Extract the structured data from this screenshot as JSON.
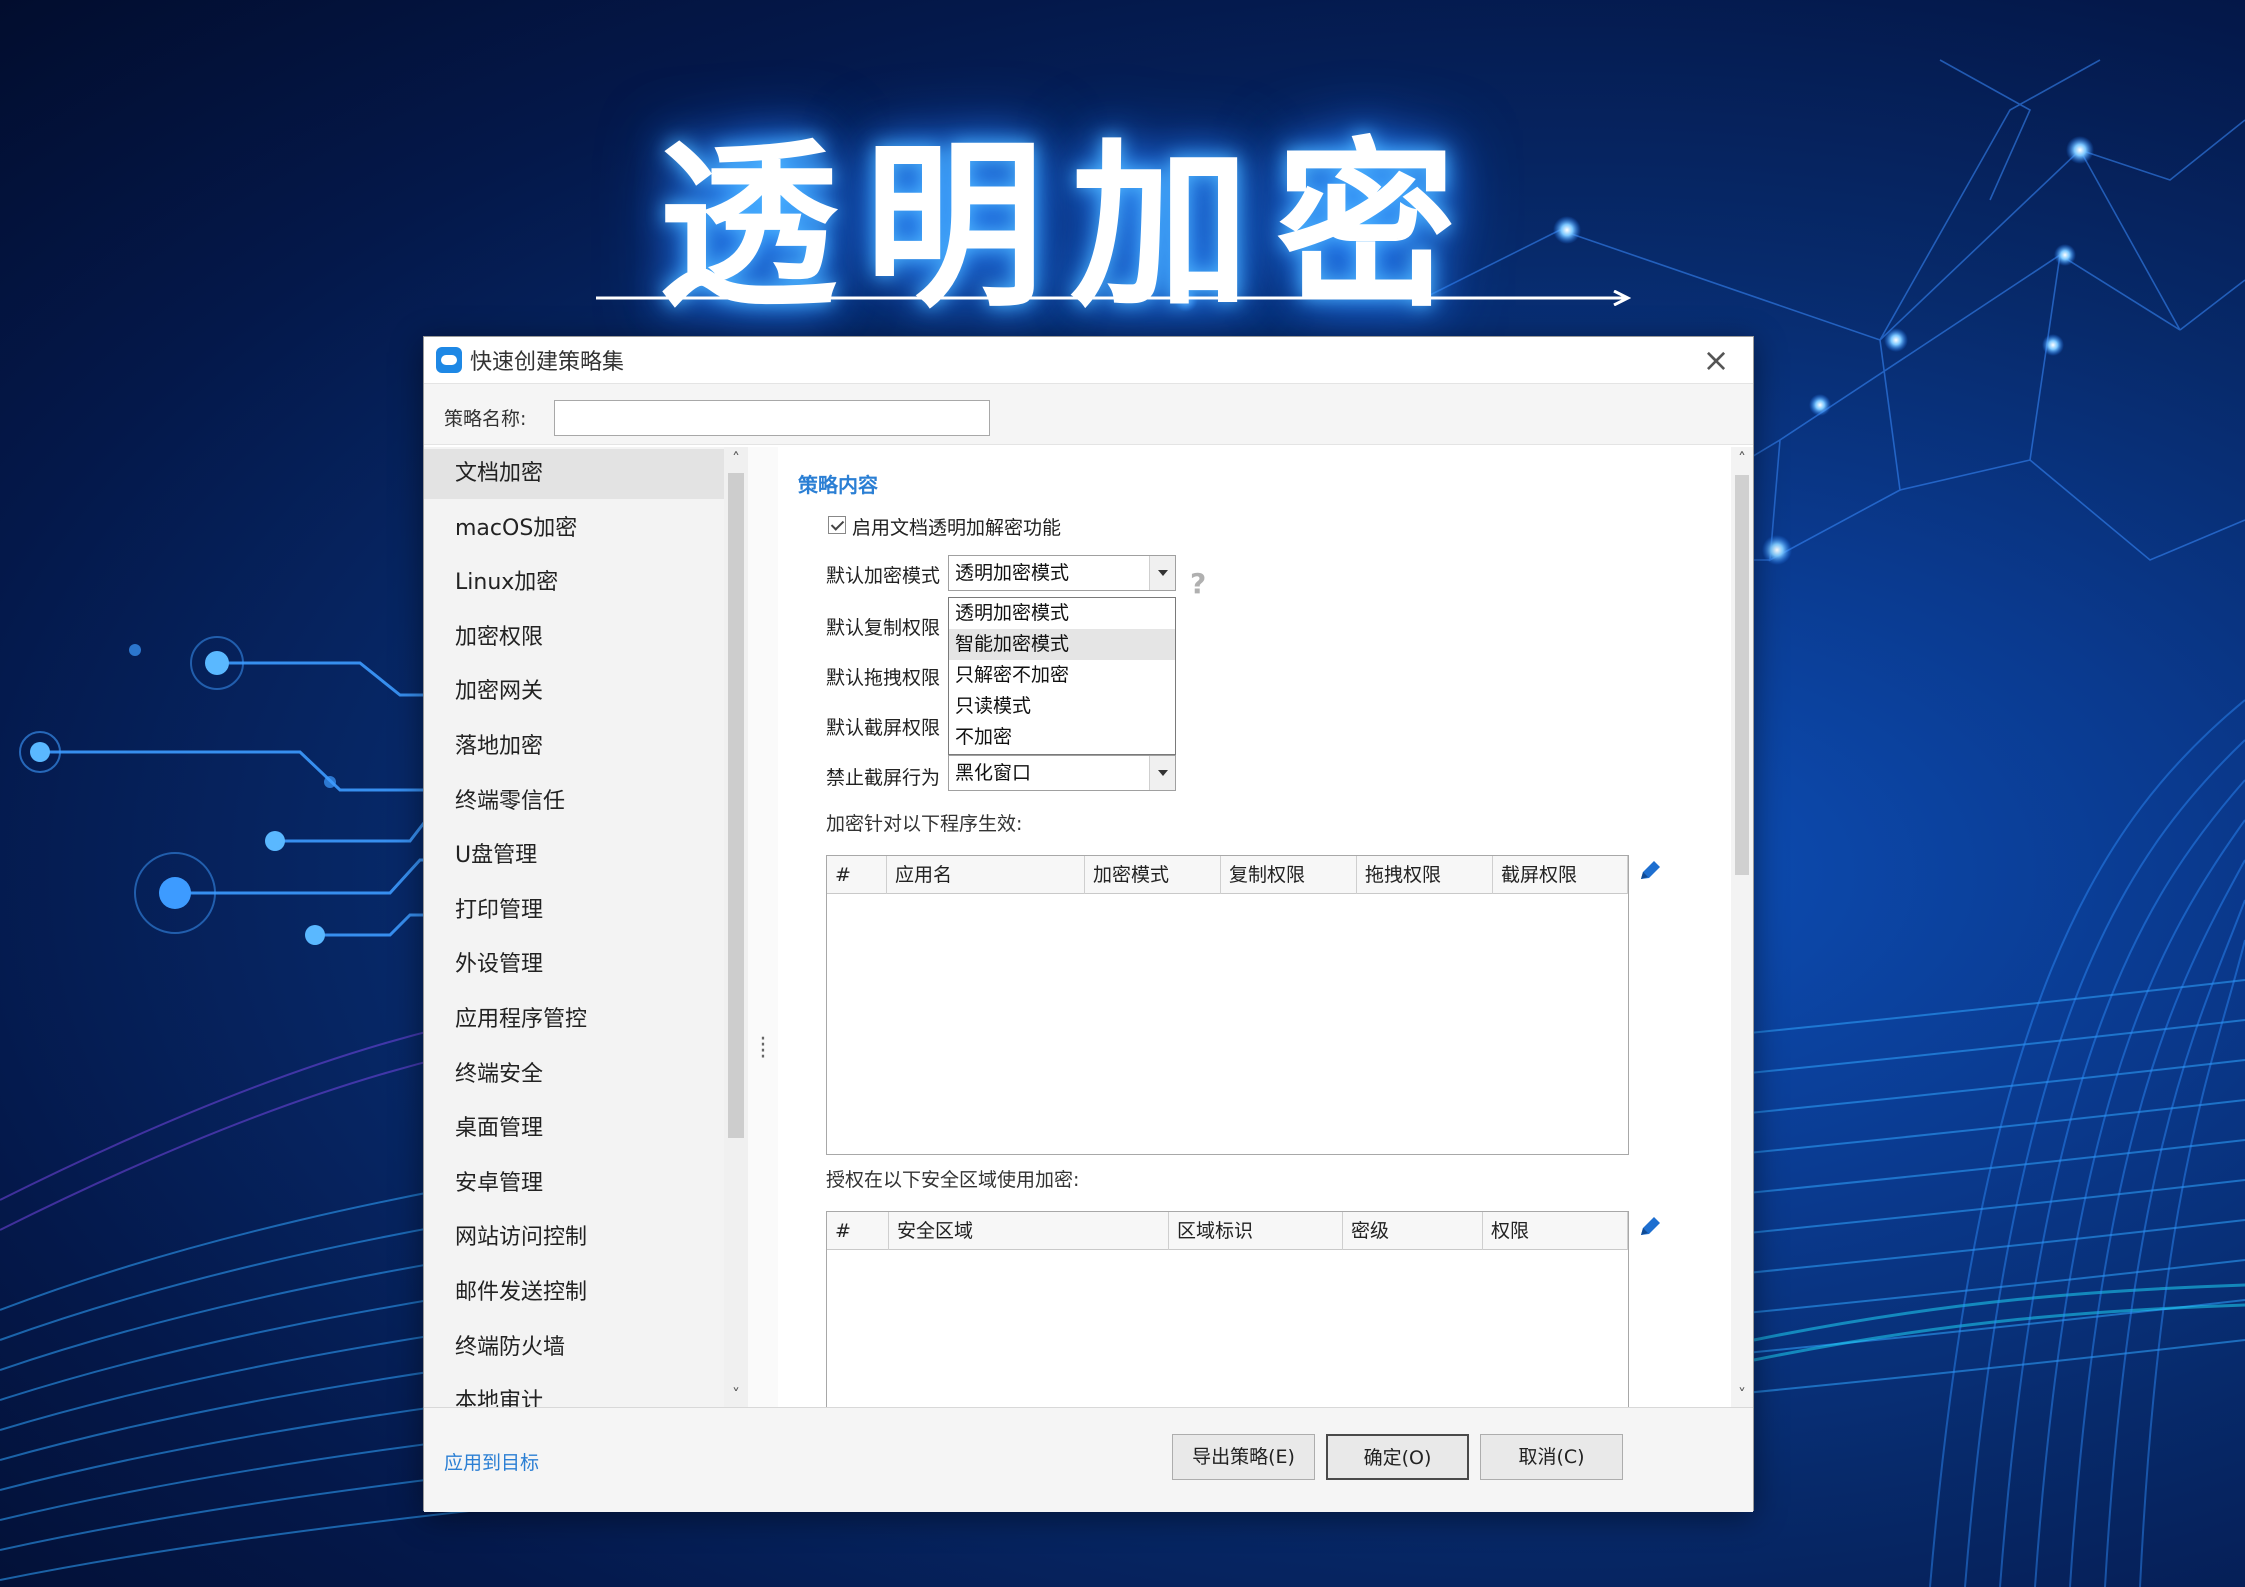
{
  "hero": {
    "title": "透明加密"
  },
  "dialog": {
    "title": "快速创建策略集",
    "close_glyph": "×",
    "policy_name_label": "策略名称:",
    "policy_name_value": "",
    "sidebar_items": [
      "文档加密",
      "macOS加密",
      "Linux加密",
      "加密权限",
      "加密网关",
      "落地加密",
      "终端零信任",
      "U盘管理",
      "打印管理",
      "外设管理",
      "应用程序管控",
      "终端安全",
      "桌面管理",
      "安卓管理",
      "网站访问控制",
      "邮件发送控制",
      "终端防火墙",
      "本地审计"
    ],
    "active_sidebar_item": "文档加密",
    "content": {
      "section_title": "策略内容",
      "enable_checkbox_label": "启用文档透明加解密功能",
      "enable_checked": true,
      "default_mode_label": "默认加密模式",
      "default_mode_value": "透明加密模式",
      "default_copy_label": "默认复制权限",
      "default_drag_label": "默认拖拽权限",
      "default_screenshot_label": "默认截屏权限",
      "forbid_screenshot_label": "禁止截屏行为",
      "forbid_screenshot_value": "黑化窗口",
      "help_glyph": "?",
      "dropdown_options": [
        "透明加密模式",
        "智能加密模式",
        "只解密不加密",
        "只读模式",
        "不加密"
      ],
      "dropdown_hover": "智能加密模式",
      "apps_label": "加密针对以下程序生效:",
      "apps_columns": [
        "#",
        "应用名",
        "加密模式",
        "复制权限",
        "拖拽权限",
        "截屏权限"
      ],
      "zones_label": "授权在以下安全区域使用加密:",
      "zones_columns": [
        "#",
        "安全区域",
        "区域标识",
        "密级",
        "权限"
      ]
    },
    "footer": {
      "apply_link": "应用到目标",
      "export_button": "导出策略(E)",
      "ok_button": "确定(O)",
      "cancel_button": "取消(C)"
    }
  },
  "colors": {
    "accent_link": "#2b7fd4",
    "background_deep": "#020d2e",
    "background_glow": "#0d4fb8",
    "network_node": "#5ab8ff"
  }
}
